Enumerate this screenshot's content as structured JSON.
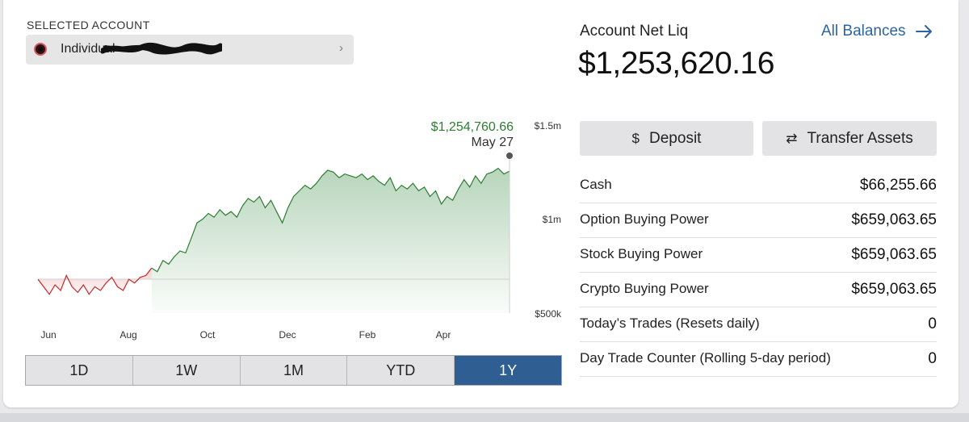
{
  "account": {
    "selected_label": "SELECTED ACCOUNT",
    "name": "Individual"
  },
  "summary": {
    "net_liq_label": "Account Net Liq",
    "net_liq_value": "$1,253,620.16",
    "all_balances_label": "All Balances"
  },
  "actions": {
    "deposit_label": "Deposit",
    "transfer_label": "Transfer Assets"
  },
  "balances": [
    {
      "label": "Cash",
      "value": "$66,255.66"
    },
    {
      "label": "Option Buying Power",
      "value": "$659,063.65"
    },
    {
      "label": "Stock Buying Power",
      "value": "$659,063.65"
    },
    {
      "label": "Crypto Buying Power",
      "value": "$659,063.65"
    },
    {
      "label": "Today’s Trades (Resets daily)",
      "value": "0"
    },
    {
      "label": "Day Trade Counter (Rolling 5-day period)",
      "value": "0"
    }
  ],
  "range_buttons": [
    "1D",
    "1W",
    "1M",
    "YTD",
    "1Y"
  ],
  "active_range": "1Y",
  "colors": {
    "gain": "#2e7d32",
    "loss": "#c62828",
    "accent": "#2f5e92",
    "link": "#2a64a5"
  },
  "chart_data": {
    "type": "area",
    "tooltip_value": "$1,254,760.66",
    "tooltip_date": "May 27",
    "x_ticks": [
      "Jun",
      "Aug",
      "Oct",
      "Dec",
      "Feb",
      "Apr"
    ],
    "y_ticks": [
      "$1.5m",
      "$1m",
      "$500k"
    ],
    "ylim": [
      500000,
      1500000
    ],
    "baseline": 680000,
    "series": [
      {
        "values": [
          680000,
          640000,
          600000,
          650000,
          620000,
          700000,
          640000,
          610000,
          650000,
          600000,
          640000,
          620000,
          660000,
          690000,
          640000,
          620000,
          680000,
          660000,
          690000,
          700000,
          740000,
          720000,
          780000,
          760000,
          800000,
          830000,
          820000,
          900000,
          980000,
          1000000,
          1030000,
          1010000,
          1050000,
          1020000,
          1040000,
          1010000,
          1070000,
          1110000,
          1090000,
          1120000,
          1060000,
          1100000,
          1040000,
          980000,
          1060000,
          1120000,
          1150000,
          1180000,
          1160000,
          1190000,
          1230000,
          1260000,
          1250000,
          1220000,
          1240000,
          1230000,
          1220000,
          1240000,
          1210000,
          1230000,
          1200000,
          1180000,
          1220000,
          1150000,
          1180000,
          1160000,
          1190000,
          1150000,
          1170000,
          1120000,
          1150000,
          1080000,
          1120000,
          1100000,
          1160000,
          1210000,
          1170000,
          1230000,
          1190000,
          1240000,
          1250000,
          1270000,
          1240000,
          1254760
        ]
      }
    ]
  }
}
